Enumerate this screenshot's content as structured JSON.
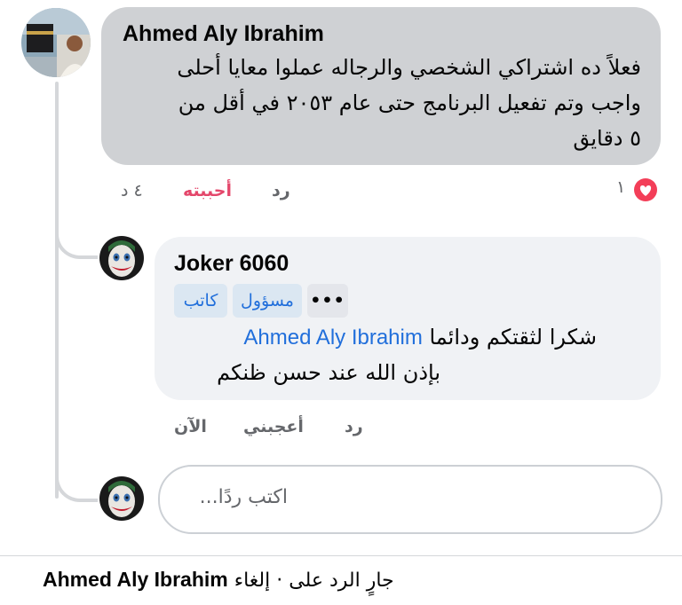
{
  "comment": {
    "author": "Ahmed Aly Ibrahim",
    "lines": [
      "فعلاً ده اشتراكي الشخصي والرجاله عملوا معايا أحلى",
      "واجب وتم تفعيل البرنامج حتى عام ٢٠٥٣ في أقل من",
      "٥ دقايق"
    ],
    "time": "٤ د",
    "like_label": "أحببته",
    "reply_label": "رد",
    "reaction_count": "١",
    "reaction_icon": "heart-reaction-icon",
    "reaction_color": "#f33e58"
  },
  "reply": {
    "author": "Joker 6060",
    "badges": [
      "مسؤول",
      "كاتب"
    ],
    "more_label": "•••",
    "text_line1_prefix": "شكرا لثقتكم ودائما",
    "mention": "Ahmed Aly Ibrahim",
    "text_line2": "بإذن الله عند حسن ظنكم",
    "time": "الآن",
    "like_label": "أعجبني",
    "reply_label": "رد"
  },
  "composer": {
    "placeholder": "اكتب ردًا..."
  },
  "footer": {
    "replying_prefix": "جارٍ الرد على",
    "name": "Ahmed Aly Ibrahim",
    "separator": "·",
    "cancel_label": "إلغاء"
  },
  "colors": {
    "accent": "#216fdb",
    "liked": "#e4476b",
    "bubble_main": "#cfd1d4",
    "bubble_reply": "#f0f2f5"
  }
}
